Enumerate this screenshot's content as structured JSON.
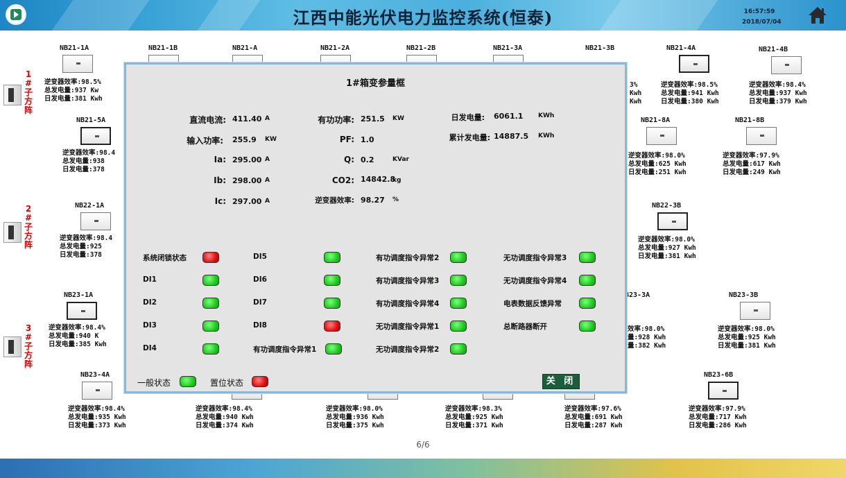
{
  "header": {
    "title": "江西中能光伏电力监控系统(恒泰)",
    "time": "16:57:59",
    "date": "2018/07/04"
  },
  "pager": "6/6",
  "groups": [
    {
      "num": "1",
      "hash": "#",
      "c1": "子",
      "c2": "方",
      "c3": "阵"
    },
    {
      "num": "2",
      "hash": "#",
      "c1": "子",
      "c2": "方",
      "c3": "阵"
    },
    {
      "num": "3",
      "hash": "#",
      "c1": "子",
      "c2": "方",
      "c3": "阵"
    }
  ],
  "inverters": [
    {
      "name": "NB21-1A",
      "l1": "逆变器效率:98.5%",
      "l2": "总发电量:937     Kw",
      "l3": "日发电量:381  Kwh"
    },
    {
      "name": "NB21-1B",
      "l1": "",
      "l2": "",
      "l3": ""
    },
    {
      "name": "NB21-A",
      "l1": "",
      "l2": "",
      "l3": ""
    },
    {
      "name": "NB21-2A",
      "l1": "",
      "l2": "",
      "l3": ""
    },
    {
      "name": "NB21-2B",
      "l1": "",
      "l2": "",
      "l3": ""
    },
    {
      "name": "NB21-3A",
      "l1": "",
      "l2": "",
      "l3": ""
    },
    {
      "name": "NB21-3B",
      "l1": "3%",
      "l2": "   Kwh",
      "l3": "Kwh"
    },
    {
      "name": "NB21-4A",
      "l1": "逆变器效率:98.5%",
      "l2": "总发电量:941     Kwh",
      "l3": "日发电量:380  Kwh"
    },
    {
      "name": "NB21-4B",
      "l1": "逆变器效率:98.4%",
      "l2": "总发电量:937     Kwh",
      "l3": "日发电量:379  Kwh"
    },
    {
      "name": "NB21-5A",
      "l1": "逆变器效率:98.4",
      "l2": "总发电量:938",
      "l3": "日发电量:378"
    },
    {
      "name": "NB21-8A",
      "l1": "逆变器效率:98.0%",
      "l2": "总发电量:625     Kwh",
      "l3": "日发电量:251  Kwh"
    },
    {
      "name": "NB21-8B",
      "l1": "逆变器效率:97.9%",
      "l2": "总发电量:617     Kwh",
      "l3": "日发电量:249  Kwh"
    },
    {
      "name": "NB22-1A",
      "l1": "逆变器效率:98.4",
      "l2": "总发电量:925",
      "l3": "日发电量:378"
    },
    {
      "name": "NB22-3B",
      "l1": "逆变器效率:98.0%",
      "l2": "总发电量:927     Kwh",
      "l3": "日发电量:381  Kwh"
    },
    {
      "name": "NB23-1A",
      "l1": "逆变器效率:98.4%",
      "l2": "总发电量:940     K",
      "l3": "日发电量:385  Kwh"
    },
    {
      "name": "B23-3A",
      "l1": "效率:98.0%",
      "l2": "量:928     Kwh",
      "l3": "量:382  Kwh"
    },
    {
      "name": "NB23-3B",
      "l1": "逆变器效率:98.0%",
      "l2": "总发电量:925     Kwh",
      "l3": "日发电量:381  Kwh"
    },
    {
      "name": "NB23-4A",
      "l1": "逆变器效率:98.4%",
      "l2": "总发电量:935     Kwh",
      "l3": "日发电量:373  Kwh"
    },
    {
      "name": "",
      "l1": "逆变器效率:98.4%",
      "l2": "总发电量:940     Kwh",
      "l3": "日发电量:374  Kwh"
    },
    {
      "name": "",
      "l1": "逆变器效率:98.0%",
      "l2": "总发电量:936     Kwh",
      "l3": "日发电量:375  Kwh"
    },
    {
      "name": "",
      "l1": "逆变器效率:98.3%",
      "l2": "总发电量:925     Kwh",
      "l3": "日发电量:371  Kwh"
    },
    {
      "name": "",
      "l1": "逆变器效率:97.6%",
      "l2": "总发电量:691     Kwh",
      "l3": "日发电量:287  Kwh"
    },
    {
      "name": "NB23-6B",
      "l1": "逆变器效率:97.9%",
      "l2": "总发电量:717     Kwh",
      "l3": "日发电量:286  Kwh"
    }
  ],
  "dialog": {
    "title": "1#箱变参量框",
    "measurements": {
      "dc_current": {
        "label": "直流电流:",
        "value": "411.40",
        "unit": "A"
      },
      "input_power": {
        "label": "输入功率:",
        "value": "255.9",
        "unit": "KW"
      },
      "ia": {
        "label": "Ia:",
        "value": "295.00",
        "unit": "A"
      },
      "ib": {
        "label": "Ib:",
        "value": "298.00",
        "unit": "A"
      },
      "ic": {
        "label": "Ic:",
        "value": "297.00",
        "unit": "A"
      },
      "active_power": {
        "label": "有功功率:",
        "value": "251.5",
        "unit": "KW"
      },
      "pf": {
        "label": "PF:",
        "value": "1.0",
        "unit": ""
      },
      "q": {
        "label": "Q:",
        "value": "0.2",
        "unit": "KVar"
      },
      "co2": {
        "label": "CO2:",
        "value": "14842.8",
        "unit": "kg"
      },
      "inv_eff": {
        "label": "逆变器效率:",
        "value": "98.27",
        "unit": "%"
      },
      "daily_gen": {
        "label": "日发电量:",
        "value": "6061.1",
        "unit": "KWh"
      },
      "total_gen": {
        "label": "累计发电量:",
        "value": "14887.5",
        "unit": "KWh"
      }
    },
    "status": [
      {
        "label": "系统闭锁状态",
        "state": "bad"
      },
      {
        "label": "DI1",
        "state": "ok"
      },
      {
        "label": "DI2",
        "state": "ok"
      },
      {
        "label": "DI3",
        "state": "ok"
      },
      {
        "label": "DI4",
        "state": "ok"
      },
      {
        "label": "DI5",
        "state": "ok"
      },
      {
        "label": "DI6",
        "state": "ok"
      },
      {
        "label": "DI7",
        "state": "ok"
      },
      {
        "label": "DI8",
        "state": "bad"
      },
      {
        "label": "有功调度指令异常1",
        "state": "ok"
      },
      {
        "label": "有功调度指令异常2",
        "state": "ok"
      },
      {
        "label": "有功调度指令异常3",
        "state": "ok"
      },
      {
        "label": "有功调度指令异常4",
        "state": "ok"
      },
      {
        "label": "无功调度指令异常1",
        "state": "ok"
      },
      {
        "label": "无功调度指令异常2",
        "state": "ok"
      },
      {
        "label": "无功调度指令异常3",
        "state": "ok"
      },
      {
        "label": "无功调度指令异常4",
        "state": "ok"
      },
      {
        "label": "电表数据反馈异常",
        "state": "ok"
      },
      {
        "label": "总断路器断开",
        "state": "ok"
      }
    ],
    "legend": {
      "normal": "一般状态",
      "set": "置位状态"
    },
    "close_label": "关 闭"
  },
  "colors": {
    "ok": "#1ecc1e",
    "bad": "#e01010",
    "accent": "#1d86c4",
    "close_button": "#1b5e3b",
    "group_label": "#e00000"
  }
}
